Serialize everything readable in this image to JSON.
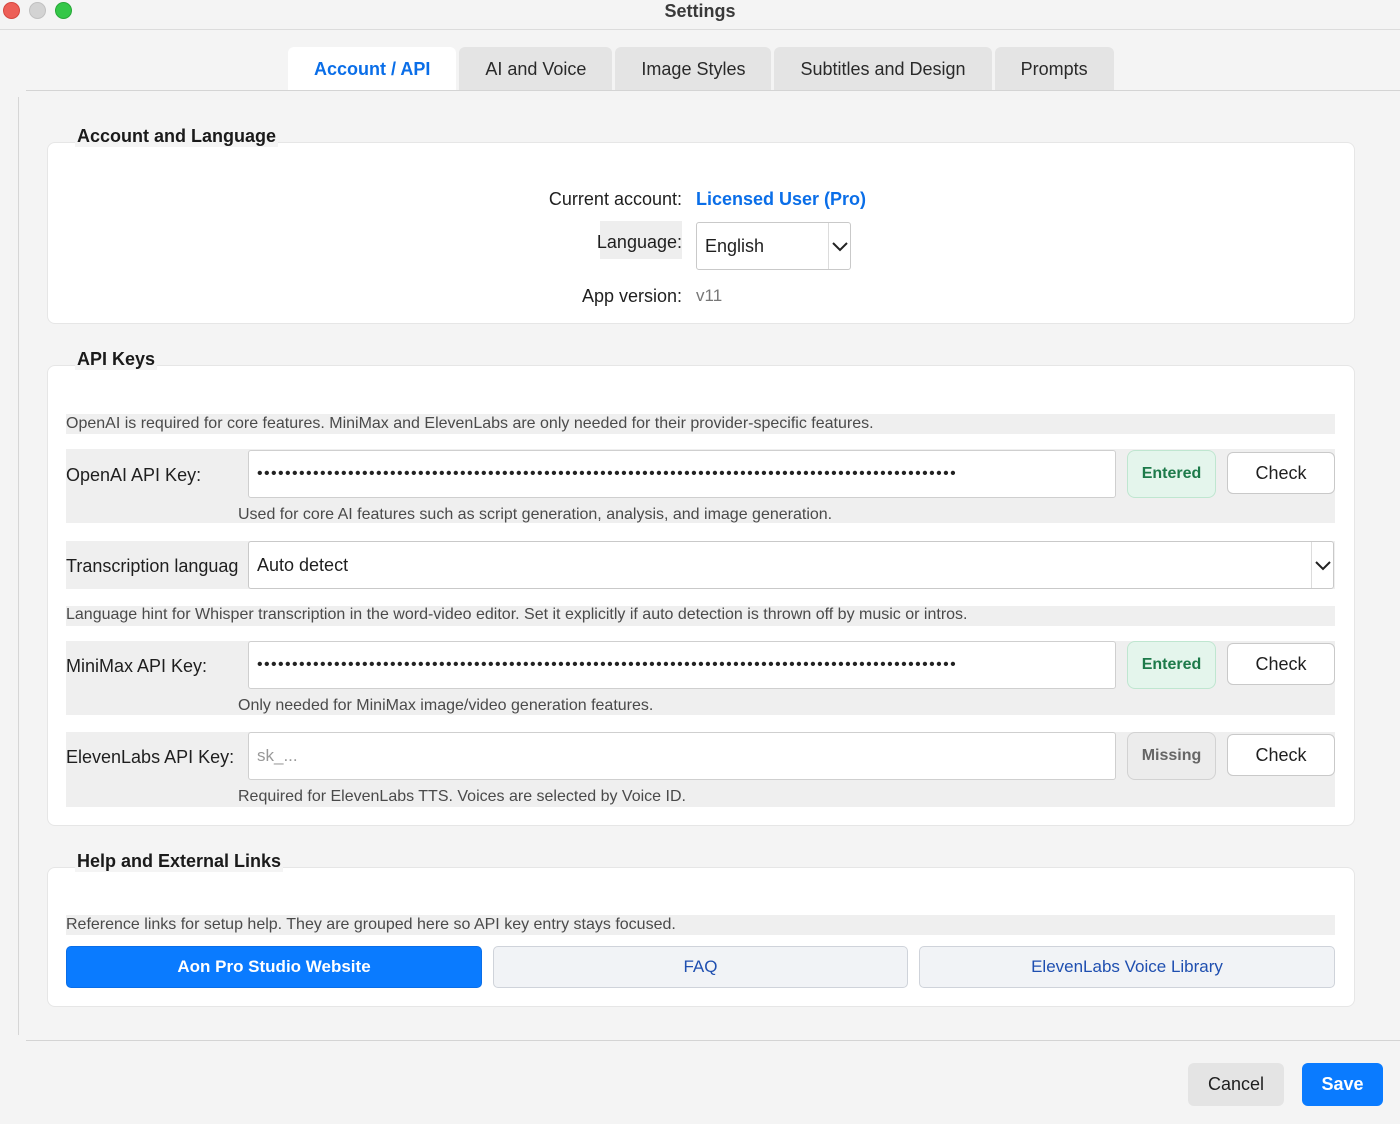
{
  "window": {
    "title": "Settings"
  },
  "tabs": [
    {
      "label": "Account / API",
      "active": true
    },
    {
      "label": "AI and Voice",
      "active": false
    },
    {
      "label": "Image Styles",
      "active": false
    },
    {
      "label": "Subtitles and Design",
      "active": false
    },
    {
      "label": "Prompts",
      "active": false
    }
  ],
  "account": {
    "title": "Account and Language",
    "current_account_label": "Current account:",
    "current_account_value": "Licensed User (Pro)",
    "language_label": "Language:",
    "language_value": "English",
    "app_version_label": "App version:",
    "app_version_value": "v11"
  },
  "api": {
    "title": "API Keys",
    "intro": "OpenAI is required for core features. MiniMax and ElevenLabs are only needed for their provider-specific features.",
    "openai": {
      "label": "OpenAI API Key:",
      "value": "••••••••••••••••••••••••••••••••••••••••••••••••••••••••••••••••••••••••••••••••••••••••••••••••••••",
      "status": "Entered",
      "check": "Check",
      "help": "Used for core AI features such as script generation, analysis, and image generation."
    },
    "transcription": {
      "label": "Transcription language:",
      "value": "Auto detect",
      "help": "Language hint for Whisper transcription in the word-video editor. Set it explicitly if auto detection is thrown off by music or intros."
    },
    "minimax": {
      "label": "MiniMax API Key:",
      "value": "••••••••••••••••••••••••••••••••••••••••••••••••••••••••••••••••••••••••••••••••••••••••••••••••••••",
      "status": "Entered",
      "check": "Check",
      "help": "Only needed for MiniMax image/video generation features."
    },
    "elevenlabs": {
      "label": "ElevenLabs API Key:",
      "placeholder": "sk_...",
      "status": "Missing",
      "check": "Check",
      "help": "Required for ElevenLabs TTS. Voices are selected by Voice ID."
    }
  },
  "links": {
    "title": "Help and External Links",
    "intro": "Reference links for setup help. They are grouped here so API key entry stays focused.",
    "website": "Aon Pro Studio Website",
    "faq": "FAQ",
    "voice_library": "ElevenLabs Voice Library"
  },
  "footer": {
    "cancel": "Cancel",
    "save": "Save"
  },
  "colors": {
    "accent": "#0a7bff",
    "ok": "#1d7a4a",
    "missing": "#666666"
  }
}
